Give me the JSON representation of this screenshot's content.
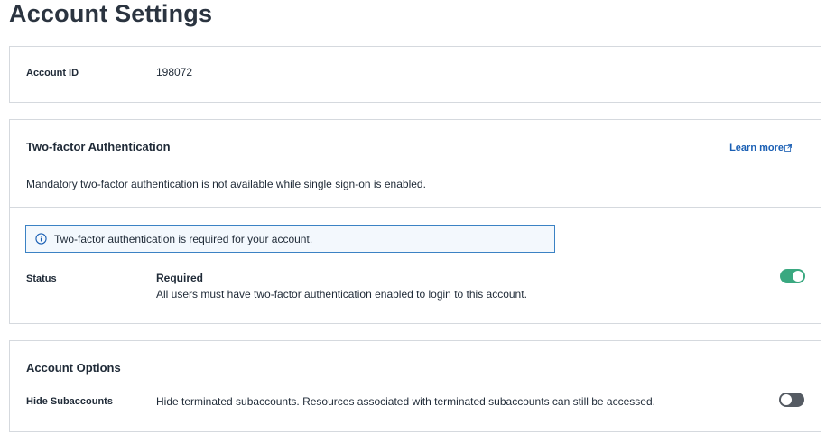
{
  "page": {
    "title": "Account Settings"
  },
  "account_id_card": {
    "label": "Account ID",
    "value": "198072"
  },
  "two_factor": {
    "heading": "Two-factor Authentication",
    "learn_more": "Learn more",
    "description": "Mandatory two-factor authentication is not available while single sign-on is enabled.",
    "banner_text": "Two-factor authentication is required for your account.",
    "status_label": "Status",
    "status_value": "Required",
    "status_description": "All users must have two-factor authentication enabled to login to this account.",
    "toggle_on": true,
    "toggle_color": "#3aa880"
  },
  "account_options": {
    "heading": "Account Options",
    "hide_subaccounts_label": "Hide Subaccounts",
    "hide_subaccounts_description": "Hide terminated subaccounts. Resources associated with terminated subaccounts can still be accessed.",
    "toggle_on": false
  },
  "icons": {
    "info": "info-circle-icon",
    "external": "external-link-icon"
  }
}
